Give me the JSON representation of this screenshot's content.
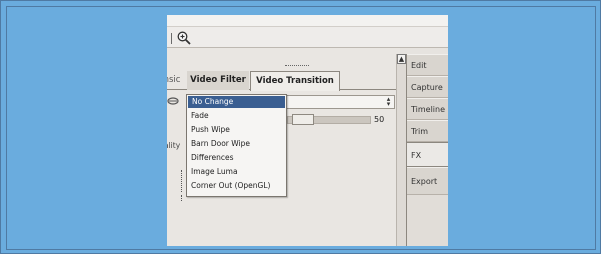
{
  "colors": {
    "page_background": "#6aacde",
    "selection": "#3a5e91",
    "panel": "#e6e3df"
  },
  "toolbar": {
    "zoom_icon": "zoom-in-icon"
  },
  "tabs": {
    "basic_partial": "nsic",
    "video_filter": "Video Filter",
    "video_transition": "Video Transition"
  },
  "left_label_partial": "ality",
  "slider": {
    "value_label": "50",
    "value_fraction": 0.5
  },
  "dropdown": {
    "items": [
      "No Change",
      "Fade",
      "Push Wipe",
      "Barn Door Wipe",
      "Differences",
      "Image Luma",
      "Corner Out (OpenGL)"
    ],
    "selected_index": 0
  },
  "right_tabs": [
    "Edit",
    "Capture",
    "Timeline",
    "Trim",
    "FX",
    "Export"
  ],
  "active_right_tab": "FX"
}
